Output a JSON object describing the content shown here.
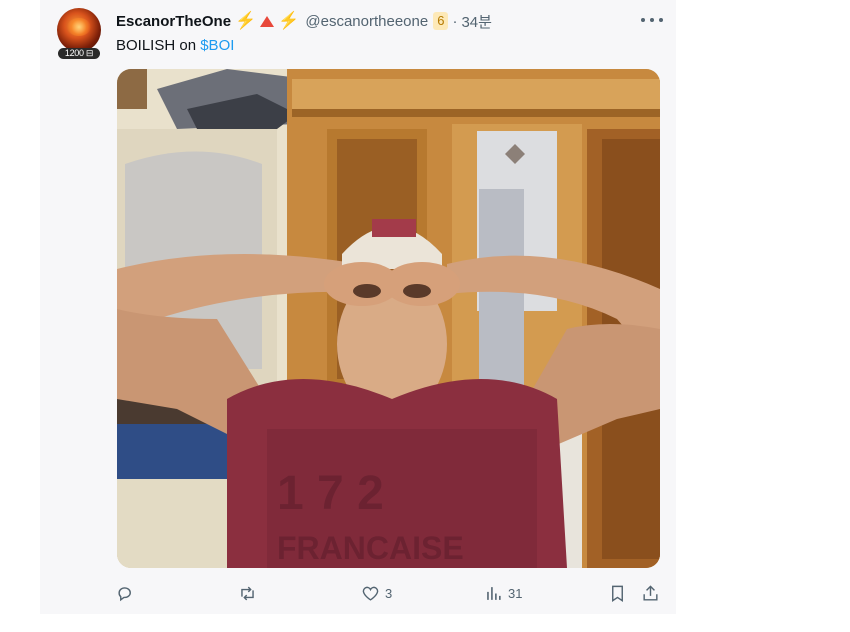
{
  "post": {
    "author_name": "EscanorTheOne",
    "author_handle": "@escanortheeone",
    "badge_number": "6",
    "separator": "·",
    "timestamp": "34분",
    "avatar_badge": "1200 ⊟",
    "text_prefix": "BOILISH on ",
    "cashtag": "$BOI",
    "emojis": [
      "bolt-icon",
      "red-triangle-icon",
      "bolt-icon"
    ]
  },
  "actions": {
    "reply_count": "",
    "repost_count": "",
    "like_count": "3",
    "views_count": "31"
  },
  "colors": {
    "link": "#1d9bf0",
    "muted": "#536471",
    "text": "#0f1419",
    "bolt": "#f5b300",
    "triangle": "#e8483b"
  }
}
